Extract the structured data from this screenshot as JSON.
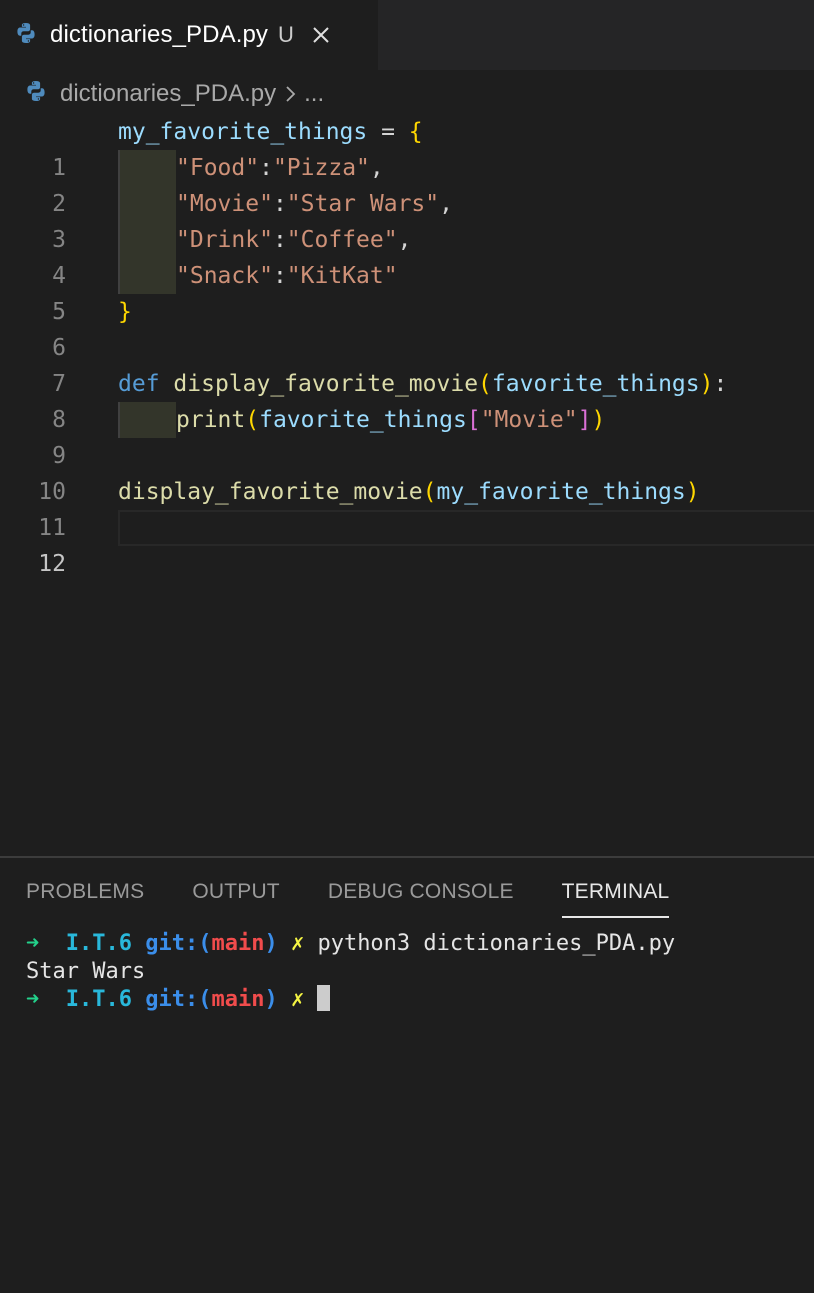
{
  "tab": {
    "filename": "dictionaries_PDA.py",
    "status": "U",
    "close_icon": "close-icon",
    "file_icon": "python-icon"
  },
  "breadcrumb": {
    "file": "dictionaries_PDA.py",
    "separator_icon": "chevron-right-icon",
    "more": "..."
  },
  "editor": {
    "line_numbers": [
      "1",
      "2",
      "3",
      "4",
      "5",
      "6",
      "7",
      "8",
      "9",
      "10",
      "11",
      "12"
    ],
    "active_line": "12",
    "code": {
      "l1_var": "my_favorite_things",
      "l1_op": " = ",
      "l1_brace": "{",
      "l2_key": "\"Food\"",
      "l2_colon": ":",
      "l2_val": "\"Pizza\"",
      "l2_comma": ",",
      "l3_key": "\"Movie\"",
      "l3_colon": ":",
      "l3_val": "\"Star Wars\"",
      "l3_comma": ",",
      "l4_key": "\"Drink\"",
      "l4_colon": ":",
      "l4_val": "\"Coffee\"",
      "l4_comma": ",",
      "l5_key": "\"Snack\"",
      "l5_colon": ":",
      "l5_val": "\"KitKat\"",
      "l6_brace": "}",
      "l8_kw": "def",
      "l8_fn": "display_favorite_movie",
      "l8_paren_open": "(",
      "l8_param": "favorite_things",
      "l8_paren_close": ")",
      "l8_colon": ":",
      "l9_fn": "print",
      "l9_paren_open": "(",
      "l9_var": "favorite_things",
      "l9_bracket_open": "[",
      "l9_str": "\"Movie\"",
      "l9_bracket_close": "]",
      "l9_paren_close": ")",
      "l11_fn": "display_favorite_movie",
      "l11_paren_open": "(",
      "l11_arg": "my_favorite_things",
      "l11_paren_close": ")"
    }
  },
  "panel": {
    "tabs": [
      "PROBLEMS",
      "OUTPUT",
      "DEBUG CONSOLE",
      "TERMINAL"
    ],
    "active_tab": "TERMINAL"
  },
  "terminal": {
    "arrow": "➜",
    "dir": "I.T.6",
    "git_prefix": "git:(",
    "branch": "main",
    "git_suffix": ")",
    "dirty": "✗",
    "command": "python3 dictionaries_PDA.py",
    "output": "Star Wars"
  }
}
